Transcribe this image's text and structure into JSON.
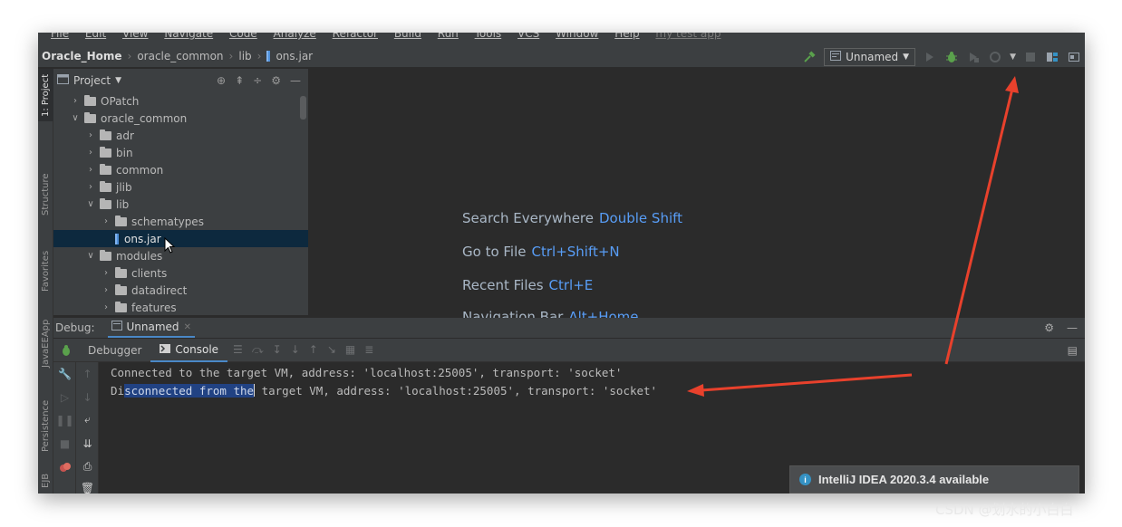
{
  "menu": {
    "items": [
      "File",
      "Edit",
      "View",
      "Navigate",
      "Code",
      "Analyze",
      "Refactor",
      "Build",
      "Run",
      "Tools",
      "VCS",
      "Window",
      "Help"
    ],
    "project_name": "my test app"
  },
  "breadcrumb": {
    "root": "Oracle_Home",
    "item1": "oracle_common",
    "item2": "lib",
    "file": "ons.jar"
  },
  "toolbar": {
    "run_config": "Unnamed"
  },
  "side_tabs": {
    "project": "1: Project",
    "structure": "Structure",
    "favorites": "Favorites",
    "javaee": "JavaEEApp",
    "persistence": "Persistence",
    "ejb": "EJB"
  },
  "project_panel": {
    "title": "Project",
    "tree": [
      {
        "label": "OPatch",
        "level": 1,
        "expanded": false,
        "type": "folder"
      },
      {
        "label": "oracle_common",
        "level": 1,
        "expanded": true,
        "type": "folder"
      },
      {
        "label": "adr",
        "level": 2,
        "expanded": false,
        "type": "folder"
      },
      {
        "label": "bin",
        "level": 2,
        "expanded": false,
        "type": "folder"
      },
      {
        "label": "common",
        "level": 2,
        "expanded": false,
        "type": "folder"
      },
      {
        "label": "jlib",
        "level": 2,
        "expanded": false,
        "type": "folder"
      },
      {
        "label": "lib",
        "level": 2,
        "expanded": true,
        "type": "folder"
      },
      {
        "label": "schematypes",
        "level": 3,
        "expanded": false,
        "type": "folder"
      },
      {
        "label": "ons.jar",
        "level": 3,
        "type": "jar",
        "selected": true
      },
      {
        "label": "modules",
        "level": 2,
        "expanded": true,
        "type": "folder"
      },
      {
        "label": "clients",
        "level": 3,
        "expanded": false,
        "type": "folder"
      },
      {
        "label": "datadirect",
        "level": 3,
        "expanded": false,
        "type": "folder"
      },
      {
        "label": "features",
        "level": 3,
        "expanded": false,
        "type": "folder"
      }
    ]
  },
  "editor_hints": [
    {
      "label": "Search Everywhere",
      "key": "Double Shift"
    },
    {
      "label": "Go to File",
      "key": "Ctrl+Shift+N"
    },
    {
      "label": "Recent Files",
      "key": "Ctrl+E"
    },
    {
      "label": "Navigation Bar",
      "key": "Alt+Home"
    }
  ],
  "debug": {
    "label": "Debug:",
    "tab": "Unnamed",
    "subtabs": {
      "debugger": "Debugger",
      "console": "Console"
    }
  },
  "console_lines": {
    "line1": "Connected to the target VM, address: 'localhost:25005', transport: 'socket'",
    "line2_pre": "Di",
    "line2_sel": "sconnected from the",
    "line2_post": " target VM, address: 'localhost:25005', transport: 'socket'"
  },
  "notification": {
    "text": "IntelliJ IDEA 2020.3.4 available"
  },
  "watermark": "CSDN @划水的小白白",
  "colors": {
    "accent": "#589df6",
    "annotation_arrow": "#e8412c",
    "selection": "#214283"
  }
}
